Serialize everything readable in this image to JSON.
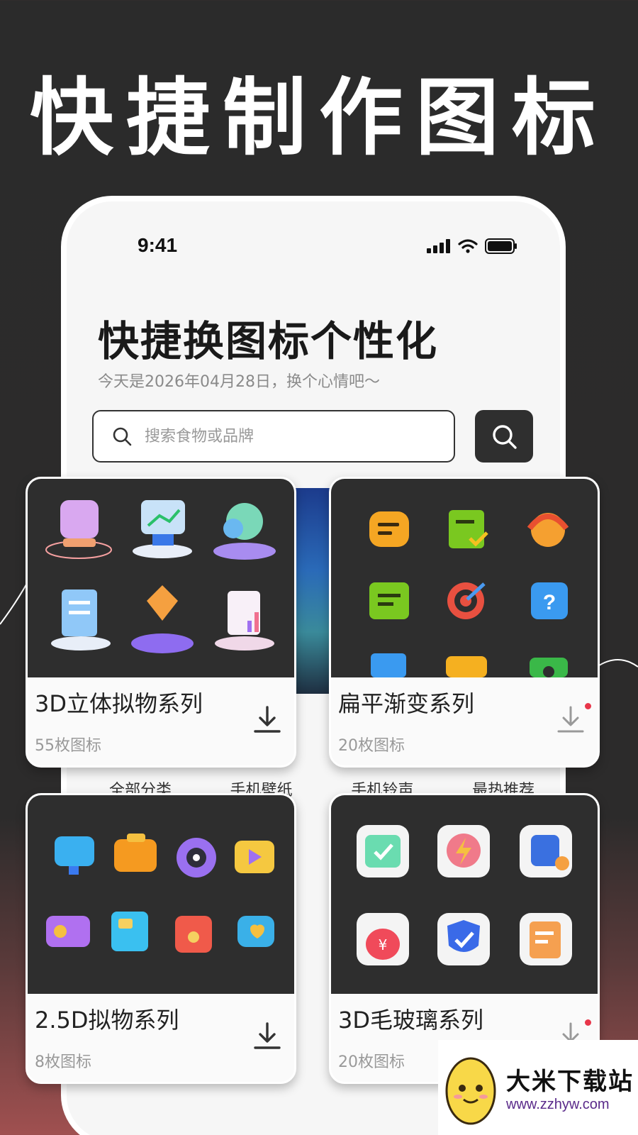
{
  "hero": {
    "title": "快捷制作图标"
  },
  "status": {
    "time": "9:41"
  },
  "phone": {
    "title": "快捷换图标个性化",
    "subtitle": "今天是2026年04月28日，换个心情吧～",
    "search": {
      "placeholder": "搜索食物或品牌"
    }
  },
  "categories": [
    "全部分类",
    "手机壁纸",
    "手机铃声",
    "最热推荐"
  ],
  "cards": [
    {
      "name": "3D立体拟物系列",
      "count": "55枚图标",
      "has_dot": false
    },
    {
      "name": "扁平渐变系列",
      "count": "20枚图标",
      "has_dot": true
    },
    {
      "name": "2.5D拟物系列",
      "count": "8枚图标",
      "has_dot": false
    },
    {
      "name": "3D毛玻璃系列",
      "count": "20枚图标",
      "has_dot": true
    }
  ],
  "watermark": {
    "name": "大米下载站",
    "url": "www.zzhyw.com"
  },
  "colors": {
    "accent_red": "#e8364a",
    "dark": "#2e2e2e"
  }
}
